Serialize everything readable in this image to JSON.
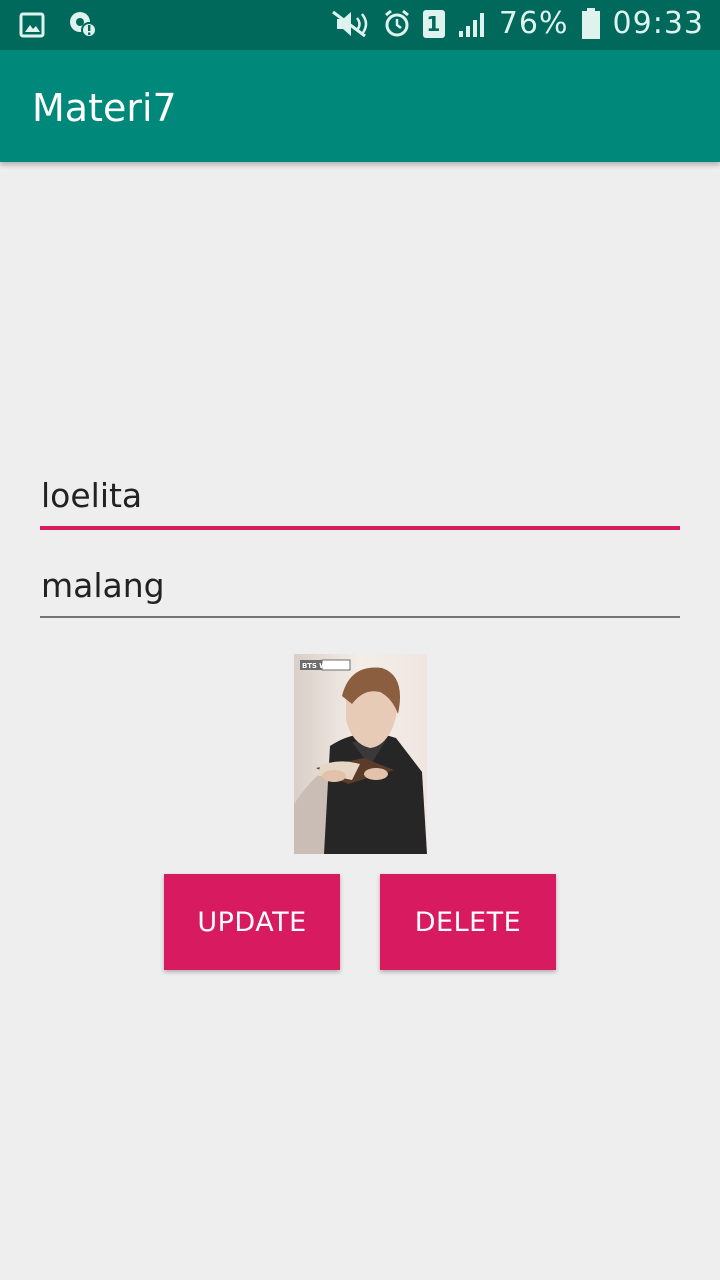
{
  "status_bar": {
    "sim_slot": "1",
    "battery": "76%",
    "time": "09:33",
    "icons": [
      "gallery-icon",
      "notification-alert-icon",
      "mute-icon",
      "alarm-icon",
      "sim-1-icon",
      "signal-icon",
      "battery-icon"
    ]
  },
  "app_bar": {
    "title": "Materi7"
  },
  "form": {
    "name_value": "loelita",
    "city_value": "malang"
  },
  "image": {
    "badge": "BTS WORLD"
  },
  "buttons": {
    "update_label": "UPDATE",
    "delete_label": "DELETE"
  },
  "colors": {
    "status_bar": "#00695c",
    "app_bar": "#00897b",
    "accent": "#d81b60",
    "background": "#eeeeee"
  }
}
